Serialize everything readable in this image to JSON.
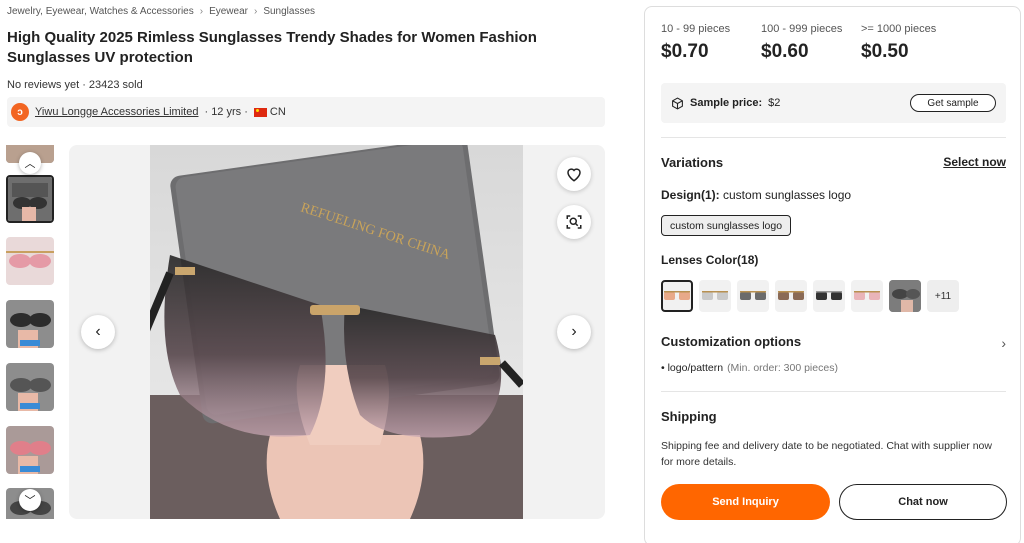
{
  "breadcrumb": [
    "Jewelry, Eyewear, Watches & Accessories",
    "Eyewear",
    "Sunglasses"
  ],
  "product": {
    "title": "High Quality 2025 Rimless Sunglasses Trendy Shades for Women Fashion Sunglasses UV protection",
    "reviews": "No reviews yet · 23423 sold",
    "case_print": "REFUELING FOR CHINA"
  },
  "supplier": {
    "logo_glyph": "ↄ",
    "name": "Yiwu Longge Accessories Limited",
    "years": "· 12 yrs ·",
    "country": "CN"
  },
  "pricing": [
    {
      "range": "10 - 99 pieces",
      "price": "$0.70"
    },
    {
      "range": "100 - 999 pieces",
      "price": "$0.60"
    },
    {
      "range": ">= 1000 pieces",
      "price": "$0.50"
    }
  ],
  "sample": {
    "label": "Sample price:",
    "value": "$2",
    "button": "Get sample"
  },
  "variations": {
    "title": "Variations",
    "select_now": "Select now",
    "design_label": "Design(1):",
    "design_value": " custom sunglasses logo",
    "design_chip": "custom sunglasses logo",
    "lens_label": "Lenses Color(18)",
    "more_swatches": "+11"
  },
  "customization": {
    "title": "Customization options",
    "item": "logo/pattern",
    "note": "(Min. order: 300 pieces)"
  },
  "shipping": {
    "title": "Shipping",
    "text": "Shipping fee and delivery date to be negotiated. Chat with supplier now for more details."
  },
  "actions": {
    "inquiry": "Send Inquiry",
    "chat": "Chat now"
  },
  "colors": {
    "accent": "#ff6600",
    "text": "#222222"
  }
}
